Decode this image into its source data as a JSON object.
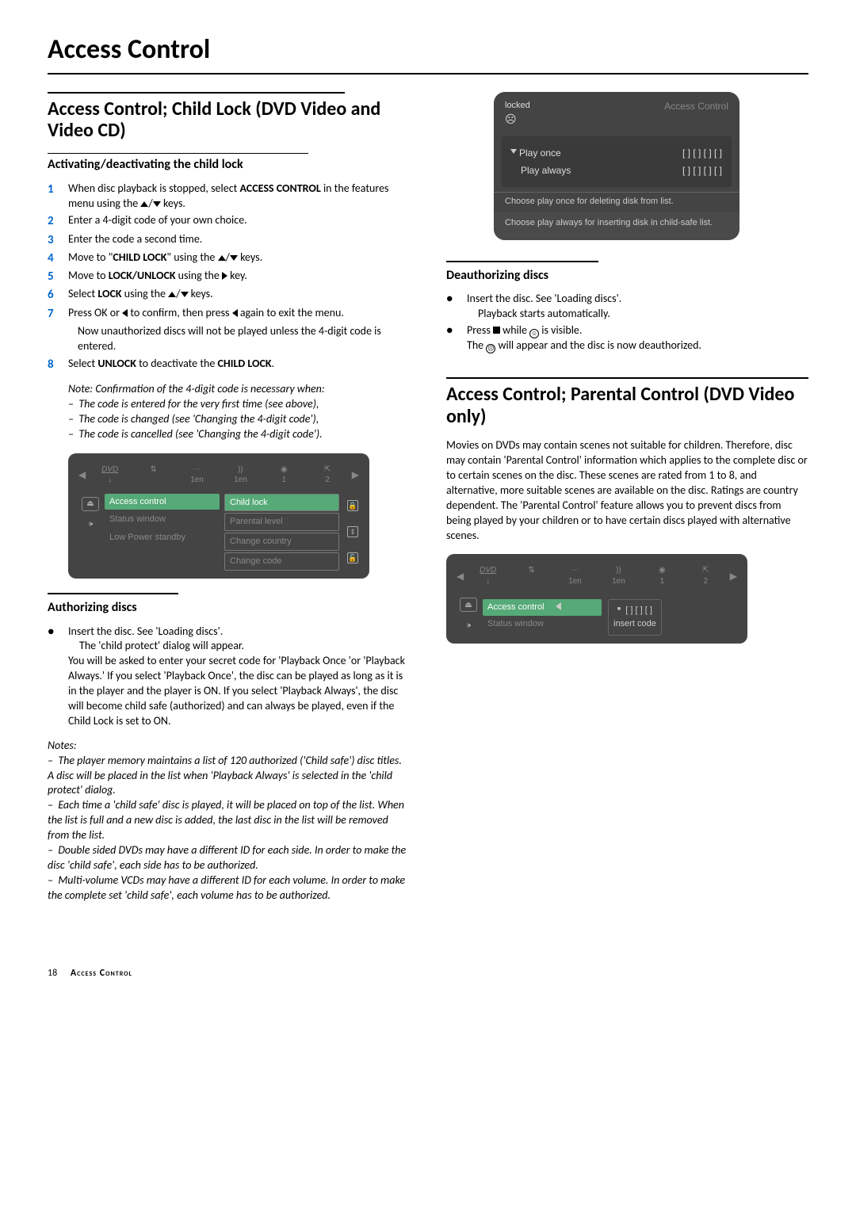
{
  "pageTitle": "Access Control",
  "section1": {
    "heading": "Access Control; Child Lock (DVD Video and Video CD)",
    "sub1": {
      "heading": "Activating/deactivating the child lock",
      "steps": [
        {
          "n": "1",
          "pre": "When disc playback is stopped, select ",
          "b1": "ACCESS CONTROL",
          "mid": " in the features menu using the ",
          "post": " keys."
        },
        {
          "n": "2",
          "text": "Enter a 4-digit code of your own choice."
        },
        {
          "n": "3",
          "text": "Enter the code a second time."
        },
        {
          "n": "4",
          "pre": "Move to \"",
          "b1": "CHILD LOCK",
          "mid": "\" using the ",
          "post": " keys."
        },
        {
          "n": "5",
          "pre": "Move to ",
          "b1": "LOCK/UNLOCK",
          "mid": " using the ",
          "post": " key."
        },
        {
          "n": "6",
          "pre": "Select ",
          "b1": "LOCK",
          "mid": " using the ",
          "post": " keys."
        },
        {
          "n": "7",
          "pre": "Press OK or ",
          "mid": " to confirm, then press ",
          "post": " again to exit the menu."
        },
        {
          "indentText": "Now unauthorized discs will not be played unless the 4-digit code is entered."
        },
        {
          "n": "8",
          "pre": "Select ",
          "b1": "UNLOCK",
          "mid": " to deactivate the ",
          "b2": "CHILD LOCK",
          "post": "."
        }
      ],
      "noteLead": "Note: Confirmation of the 4-digit code is necessary when:",
      "notes": [
        "The code is entered for the very first time (see above),",
        "The code is changed (see 'Changing the 4-digit code'),",
        "The code is cancelled (see 'Changing the 4-digit code')."
      ]
    },
    "shot1": {
      "tabs": {
        "t1": "1en",
        "t2": "1en",
        "t3": "1",
        "t4": "2"
      },
      "leftCol": [
        "Access control",
        "Status window",
        "Low Power standby"
      ],
      "rightCol": [
        "Child lock",
        "Parental level",
        "Change country",
        "Change code"
      ]
    },
    "sub2": {
      "heading": "Authorizing discs",
      "b1": "Insert the disc. See 'Loading discs'.",
      "b1a": "The 'child protect' dialog will appear.",
      "b1b": "You will be asked to enter your secret code for 'Playback Once 'or 'Playback Always.' If you select 'Playback Once', the disc can be played as long as it is in the player and the player is ON. If you select 'Playback Always', the disc will become child safe (authorized) and can always be played, even if the Child Lock is set to ON.",
      "notesHead": "Notes:",
      "notes": [
        "The player memory maintains a list of 120 authorized ('Child safe') disc titles. A disc will be placed in the list when 'Playback Always' is selected in the 'child protect' dialog.",
        "Each time a 'child safe' disc is played, it will be placed on top of the list. When the list is full and a new disc is added, the last disc in the list will be removed from the list.",
        "Double sided DVDs may have a different ID for each side. In order to make the disc 'child safe', each side has to be authorized.",
        "Multi-volume VCDs may have a different ID for each volume. In order to make the complete set 'child safe', each volume has to be authorized."
      ]
    }
  },
  "dialog": {
    "locked": "locked",
    "title": "Access Control",
    "opt1": "Play once",
    "opt2": "Play always",
    "code": "[ ]  [ ]  [ ]  [ ]",
    "msg1": "Choose play once for deleting disk from list.",
    "msg2": "Choose play always for inserting disk in child-safe list."
  },
  "section2": {
    "heading": "Deauthorizing discs",
    "b1": "Insert the disc. See 'Loading discs'.",
    "b1a": "Playback starts automatically.",
    "b2pre": "Press ",
    "b2mid": " while ",
    "b2post": " is visible.",
    "b2a_pre": "The ",
    "b2a_post": " will appear and the disc is now deauthorized."
  },
  "section3": {
    "heading": "Access Control; Parental Control (DVD Video only)",
    "body": "Movies on DVDs may contain scenes not suitable for children. Therefore, disc may contain 'Parental Control' information which applies to the complete disc or to certain scenes on the disc. These scenes are rated from 1 to 8, and alternative, more suitable scenes are available on the disc. Ratings are country dependent. The 'Parental Control' feature allows you to prevent discs from being played by your children or to have certain discs played with alternative scenes."
  },
  "shot2": {
    "tabs": {
      "t1": "1en",
      "t2": "1en",
      "t3": "1",
      "t4": "2"
    },
    "leftCol": [
      "Access control",
      "Status window"
    ],
    "code": "[ ]  [ ]  [ ]",
    "insert": "insert code"
  },
  "footer": {
    "page": "18",
    "title": "Access Control"
  }
}
